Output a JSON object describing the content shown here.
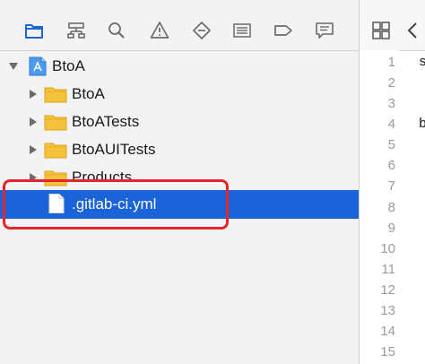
{
  "toolbar": {
    "icons": [
      {
        "name": "folder-icon",
        "active": true
      },
      {
        "name": "hierarchy-icon",
        "active": false
      },
      {
        "name": "search-icon",
        "active": false
      },
      {
        "name": "warning-icon",
        "active": false
      },
      {
        "name": "test-diamond-icon",
        "active": false
      },
      {
        "name": "list-icon",
        "active": false
      },
      {
        "name": "tag-icon",
        "active": false
      },
      {
        "name": "comment-icon",
        "active": false
      }
    ],
    "active_color": "#1b63d8",
    "inactive_color": "#6b6b6b"
  },
  "editor_toolbar": {
    "icons": [
      "grid-icon",
      "chevron-left-icon"
    ]
  },
  "tree": {
    "project": {
      "label": "BtoA",
      "icon": "project-app-icon"
    },
    "groups": [
      {
        "label": "BtoA",
        "icon": "folder-icon"
      },
      {
        "label": "BtoATests",
        "icon": "folder-icon"
      },
      {
        "label": "BtoAUITests",
        "icon": "folder-icon"
      },
      {
        "label": "Products",
        "icon": "folder-icon"
      }
    ],
    "selected_file": {
      "label": ".gitlab-ci.yml",
      "icon": "file-icon"
    }
  },
  "editor": {
    "line_numbers": [
      "1",
      "2",
      "3",
      "4",
      "5",
      "6",
      "7",
      "8",
      "9",
      "10",
      "11",
      "12",
      "13",
      "14",
      "15"
    ],
    "visible_code_fragments": [
      {
        "line": "1",
        "text": "s"
      },
      {
        "line": "4",
        "text": "b"
      }
    ]
  },
  "colors": {
    "selection": "#1b63d8",
    "annotation": "#e4252b",
    "folder": "#f5c33b"
  }
}
